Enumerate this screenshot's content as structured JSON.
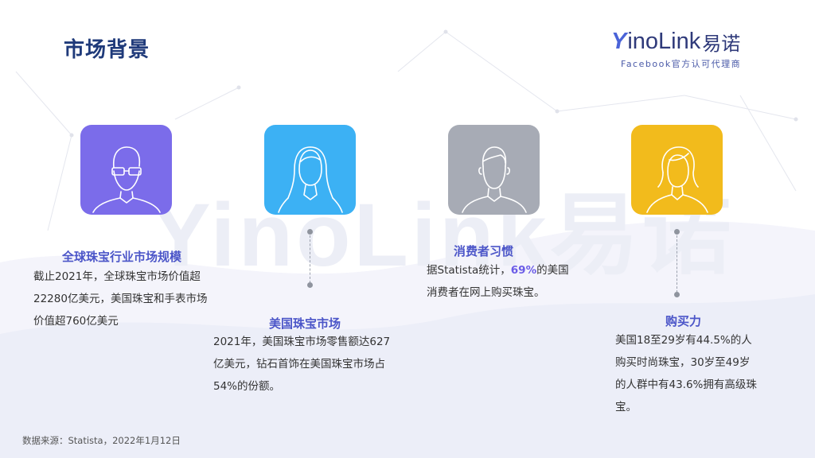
{
  "page": {
    "title": "市场背景"
  },
  "logo": {
    "prefix": "Y",
    "brand": "inoLink",
    "brand_cn": "易诺",
    "subtitle": "Facebook官方认可代理商"
  },
  "watermark": "YinoLink易诺",
  "colors": {
    "purple": "#7b6cea",
    "blue": "#3cb1f4",
    "gray": "#a7abb5",
    "yellow": "#f2bb1c",
    "heading": "#4b55c8",
    "title": "#1f3a7a"
  },
  "items": [
    {
      "icon": "man-with-glasses-icon",
      "heading": "全球珠宝行业市场规模",
      "lines": [
        "截止2021年，全球珠宝市场价值超",
        "22280亿美元，美国珠宝和手表市场",
        "价值超760亿美元"
      ]
    },
    {
      "icon": "woman-long-hair-icon",
      "heading": "美国珠宝市场",
      "lines": [
        "2021年，美国珠宝市场零售额达627",
        "亿美元，钻石首饰在美国珠宝市场占",
        "54%的份额。"
      ]
    },
    {
      "icon": "man-short-hair-icon",
      "heading": "消费者习惯",
      "line1_pre": "据Statista统计，",
      "line1_highlight": "69%",
      "line1_post": "的美国",
      "line2": "消费者在网上购买珠宝。"
    },
    {
      "icon": "woman-bob-hair-icon",
      "heading": "购买力",
      "lines": [
        "美国18至29岁有44.5%的人",
        "购买时尚珠宝，30岁至49岁",
        "的人群中有43.6%拥有高级珠",
        "宝。"
      ]
    }
  ],
  "source": "数据来源：Statista，2022年1月12日"
}
